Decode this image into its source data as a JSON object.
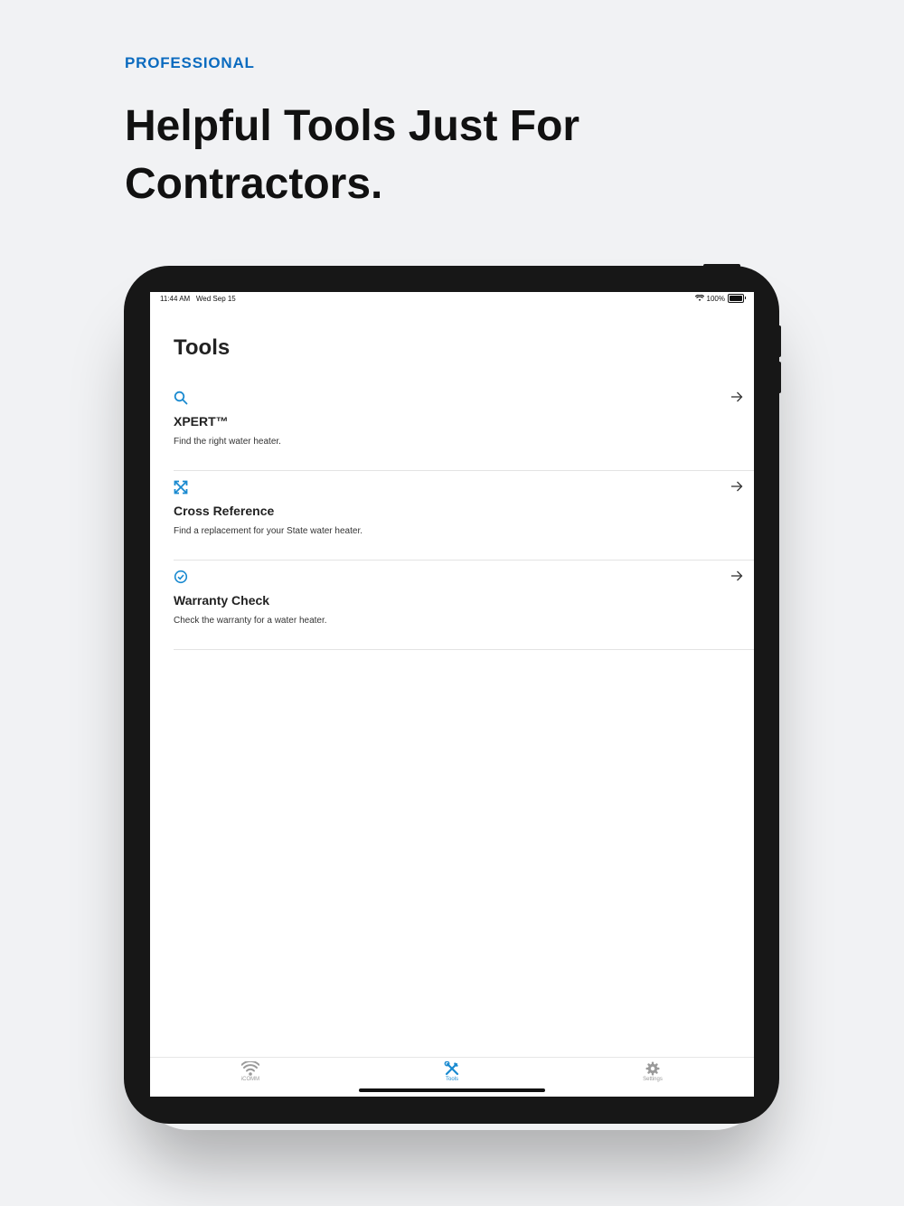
{
  "marketing": {
    "eyebrow": "PROFESSIONAL",
    "headline": "Helpful Tools Just For Contractors."
  },
  "status_bar": {
    "time": "11:44 AM   Wed Sep 15",
    "battery": "100%"
  },
  "screen": {
    "title": "Tools",
    "tools": [
      {
        "name": "XPERT™",
        "description": "Find the right water heater.",
        "icon": "search-icon"
      },
      {
        "name": "Cross Reference",
        "description": "Find a replacement for your State water heater.",
        "icon": "expand-arrows-icon"
      },
      {
        "name": "Warranty Check",
        "description": "Check the warranty for a water heater.",
        "icon": "check-circle-icon"
      }
    ]
  },
  "tab_bar": {
    "tabs": [
      {
        "label": "iCOMM",
        "icon": "wifi-icon",
        "active": false
      },
      {
        "label": "Tools",
        "icon": "tools-icon",
        "active": true
      },
      {
        "label": "Settings",
        "icon": "gear-icon",
        "active": false
      }
    ]
  },
  "colors": {
    "accent": "#1a8ad0",
    "eyebrow": "#0b6bbf",
    "background": "#f1f2f4",
    "device": "#171717"
  }
}
